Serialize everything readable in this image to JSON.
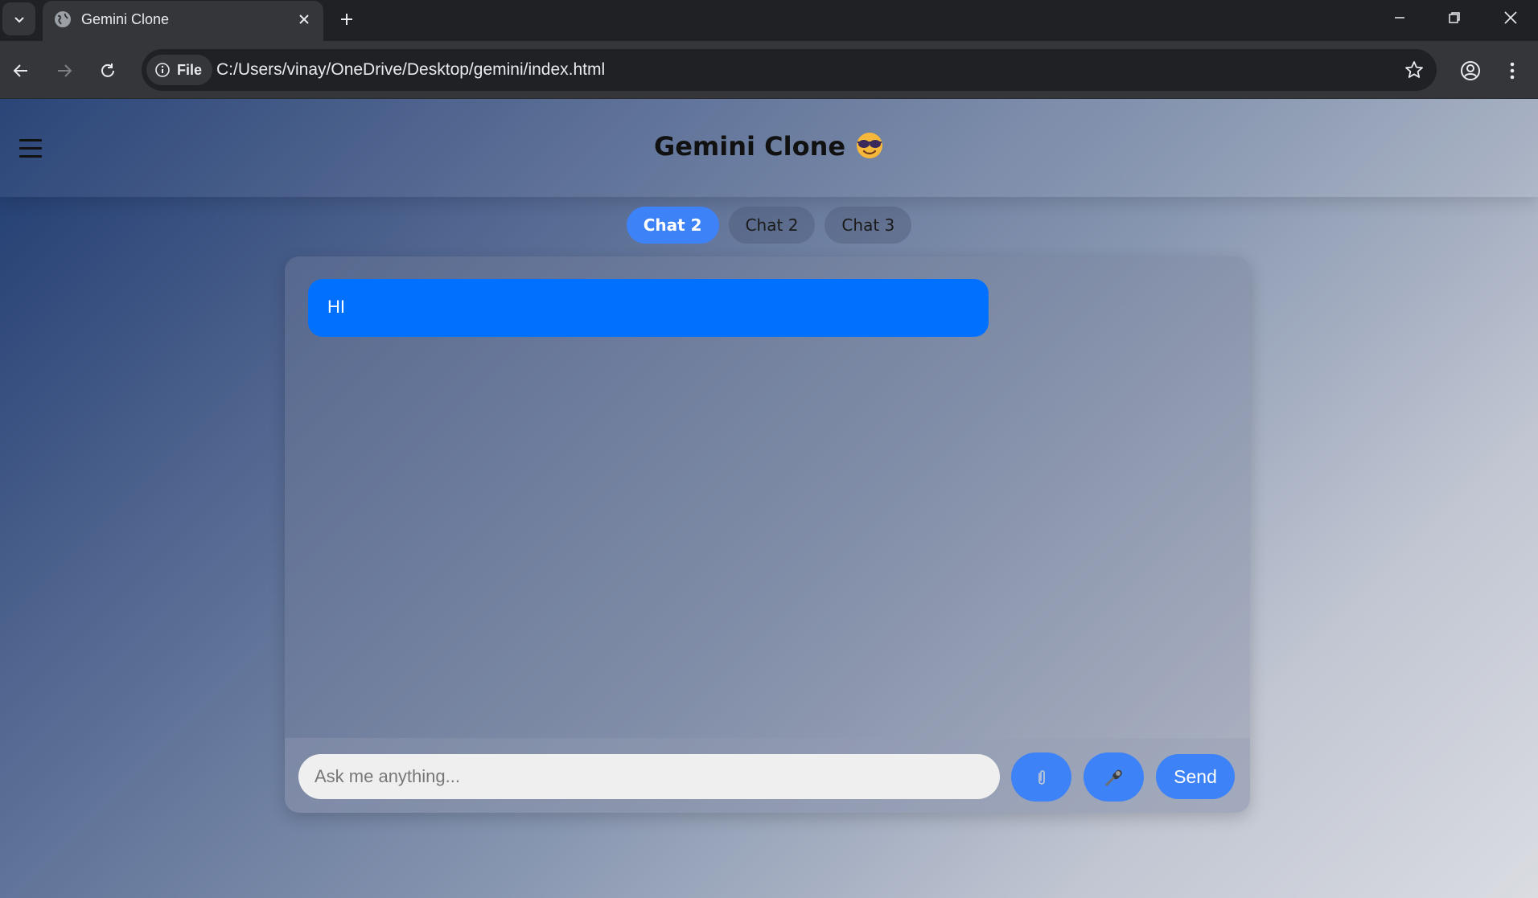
{
  "browser": {
    "tab_title": "Gemini Clone",
    "site_chip_label": "File",
    "url": "C:/Users/vinay/OneDrive/Desktop/gemini/index.html"
  },
  "app": {
    "title": "Gemini Clone",
    "title_emoji": "smiling-face-with-sunglasses",
    "chat_tabs": [
      {
        "label": "Chat 2",
        "active": true
      },
      {
        "label": "Chat 2",
        "active": false
      },
      {
        "label": "Chat 3",
        "active": false
      }
    ],
    "messages": [
      {
        "text": "HI",
        "role": "user"
      }
    ],
    "input": {
      "placeholder": "Ask me anything...",
      "value": ""
    },
    "buttons": {
      "attach_icon": "paperclip-icon",
      "mic_icon": "microphone-icon",
      "send_label": "Send"
    }
  },
  "colors": {
    "accent": "#3d82f7",
    "user_bubble": "#0071ff"
  }
}
